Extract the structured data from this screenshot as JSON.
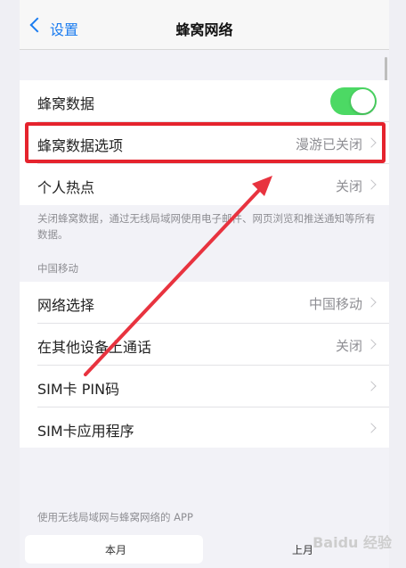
{
  "navbar": {
    "back_label": "设置",
    "title": "蜂窝网络"
  },
  "group1": {
    "cellular_data_label": "蜂窝数据",
    "cellular_data_on": true,
    "cellular_options_label": "蜂窝数据选项",
    "cellular_options_value": "漫游已关闭",
    "hotspot_label": "个人热点",
    "hotspot_value": "关闭"
  },
  "footnote": "关闭蜂窝数据，通过无线局域网使用电子邮件、网页浏览和推送通知等所有数据。",
  "carrier_header": "中国移动",
  "group2": {
    "network_label": "网络选择",
    "network_value": "中国移动",
    "calls_label": "在其他设备上通话",
    "calls_value": "关闭",
    "sim_pin_label": "SIM卡 PIN码",
    "sim_apps_label": "SIM卡应用程序"
  },
  "usage_header": "使用无线局域网与蜂窝网络的 APP",
  "segment": {
    "this_month": "本月",
    "last_month": "上月"
  },
  "watermark": "Baidu 经验",
  "colors": {
    "accent": "#1a7cf0",
    "toggle_on": "#4cd964",
    "highlight": "#e5232d",
    "arrow": "#e8333f"
  }
}
